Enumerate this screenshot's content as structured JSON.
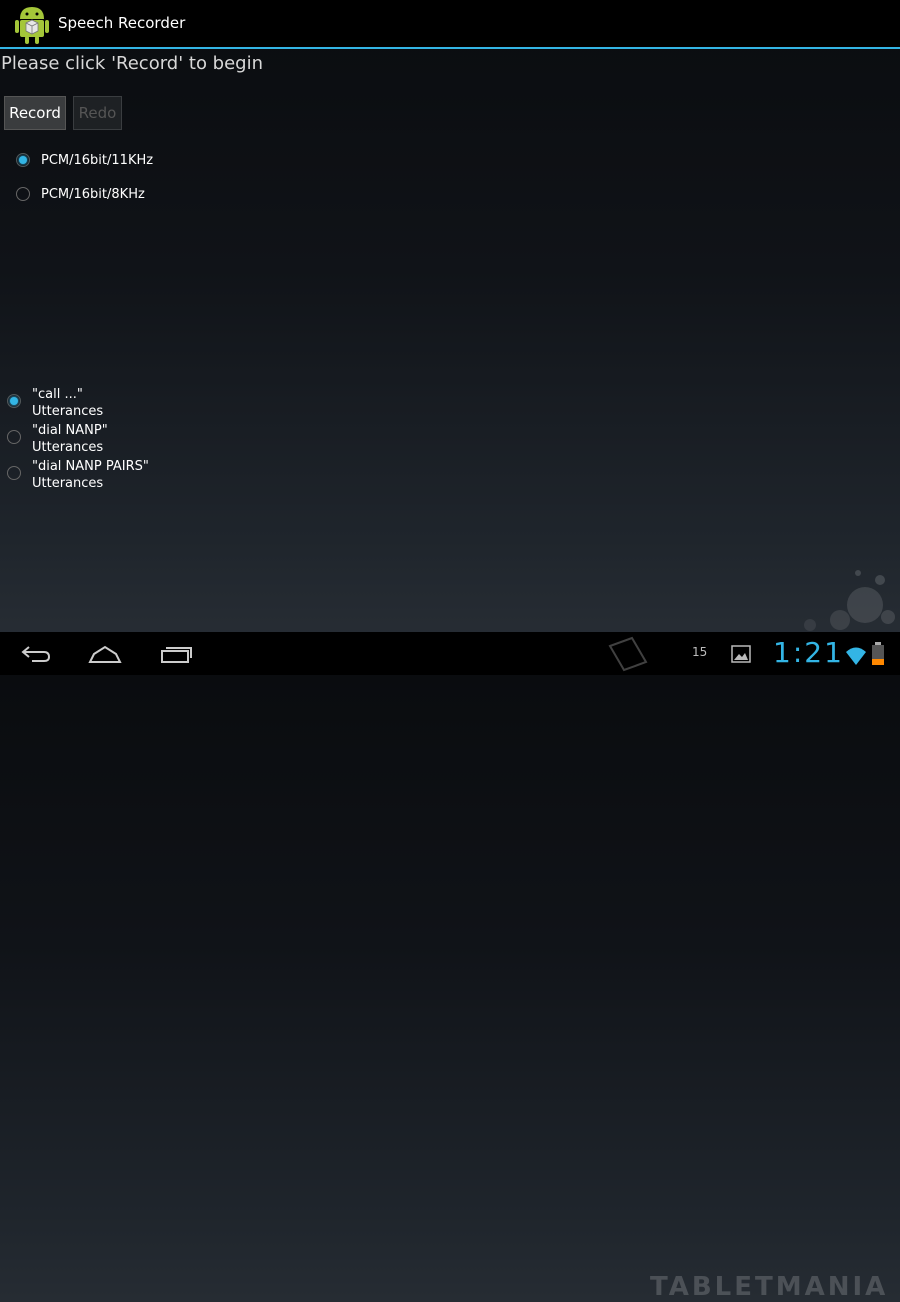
{
  "app": {
    "title": "Speech Recorder"
  },
  "prompt": "Please click 'Record' to begin",
  "buttons": {
    "record": "Record",
    "redo": "Redo"
  },
  "formats": [
    {
      "label": "PCM/16bit/11KHz",
      "checked": true
    },
    {
      "label": "PCM/16bit/8KHz",
      "checked": false
    }
  ],
  "utterances": [
    {
      "line1": "\"call ...\"",
      "line2": "Utterances",
      "checked": true
    },
    {
      "line1": "\"dial NANP\"",
      "line2": "Utterances",
      "checked": false
    },
    {
      "line1": "\"dial NANP PAIRS\"",
      "line2": "Utterances",
      "checked": false
    }
  ],
  "status": {
    "notification_count": "15",
    "clock": "1:21"
  },
  "watermark": "TABLETMANIA",
  "colors": {
    "accent": "#33b5e5",
    "action_bar": "#000000"
  },
  "icons": [
    "android-app-icon",
    "back-icon",
    "home-icon",
    "recent-apps-icon",
    "picture-icon",
    "wifi-icon",
    "battery-icon",
    "tablet-icon"
  ]
}
